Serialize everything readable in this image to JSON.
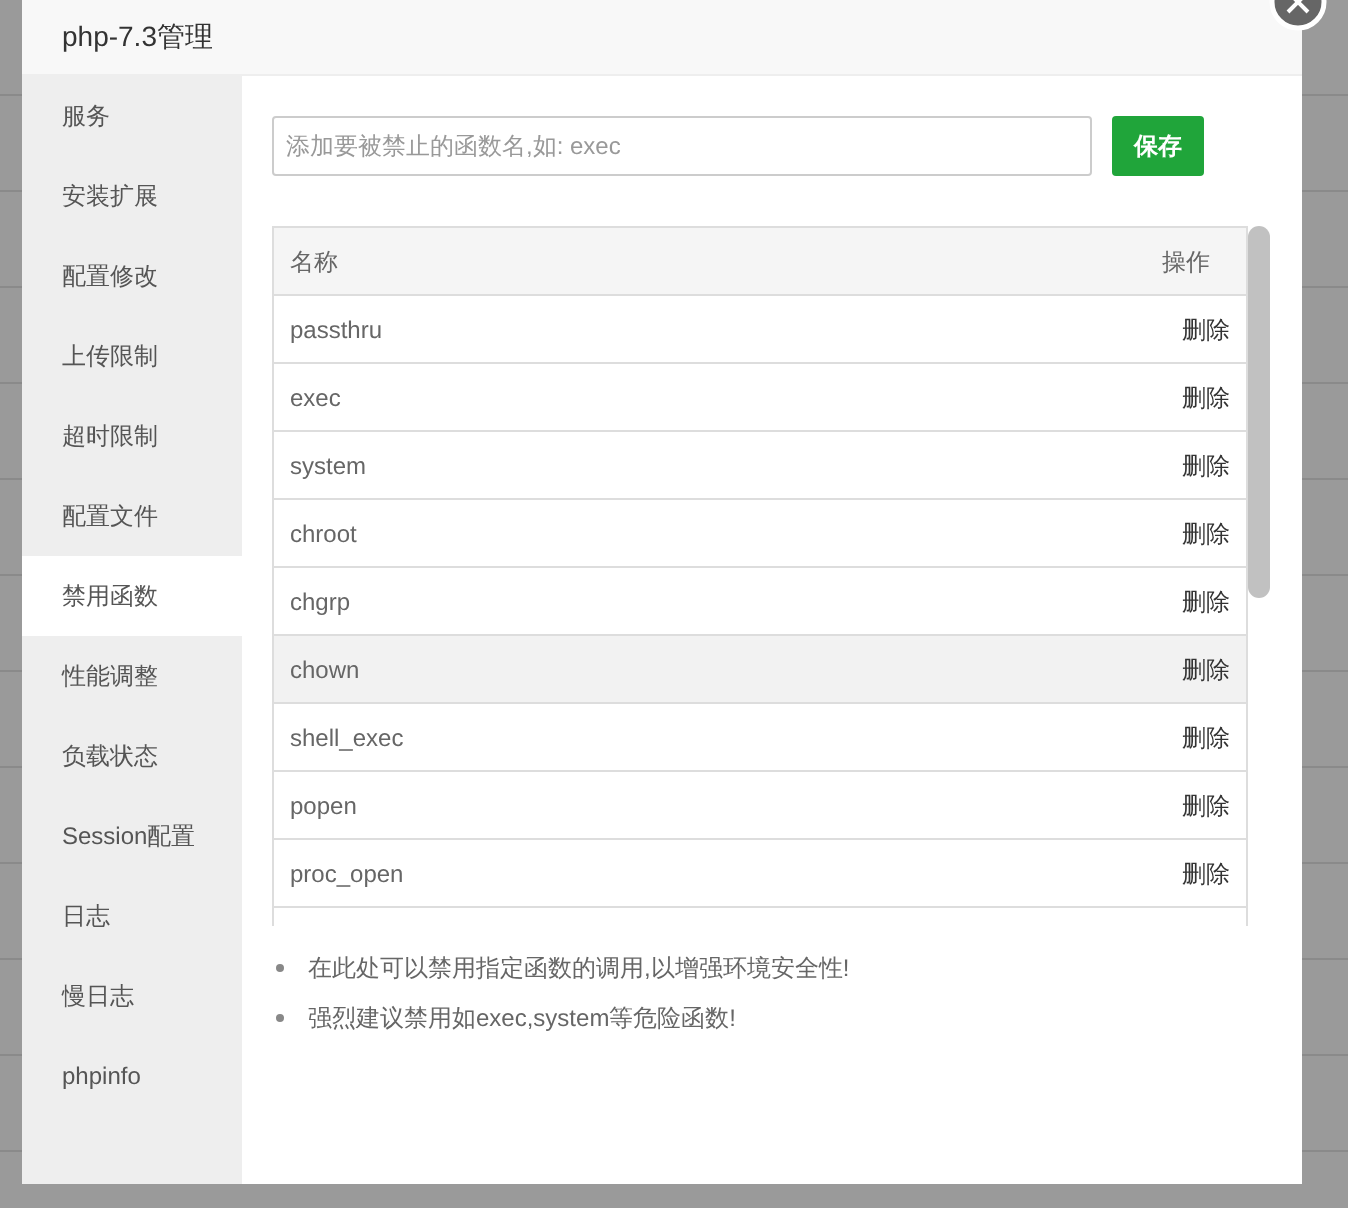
{
  "dialog": {
    "title": "php-7.3管理"
  },
  "sidebar": {
    "items": [
      {
        "label": "服务",
        "selected": false
      },
      {
        "label": "安装扩展",
        "selected": false
      },
      {
        "label": "配置修改",
        "selected": false
      },
      {
        "label": "上传限制",
        "selected": false
      },
      {
        "label": "超时限制",
        "selected": false
      },
      {
        "label": "配置文件",
        "selected": false
      },
      {
        "label": "禁用函数",
        "selected": true
      },
      {
        "label": "性能调整",
        "selected": false
      },
      {
        "label": "负载状态",
        "selected": false
      },
      {
        "label": "Session配置",
        "selected": false
      },
      {
        "label": "日志",
        "selected": false
      },
      {
        "label": "慢日志",
        "selected": false
      },
      {
        "label": "phpinfo",
        "selected": false
      }
    ]
  },
  "function_input": {
    "placeholder": "添加要被禁止的函数名,如: exec"
  },
  "save_button": "保存",
  "table": {
    "columns": [
      "名称",
      "操作"
    ],
    "rows": [
      {
        "name": "passthru",
        "action": "删除",
        "highlighted": false
      },
      {
        "name": "exec",
        "action": "删除",
        "highlighted": false
      },
      {
        "name": "system",
        "action": "删除",
        "highlighted": false
      },
      {
        "name": "chroot",
        "action": "删除",
        "highlighted": false
      },
      {
        "name": "chgrp",
        "action": "删除",
        "highlighted": false
      },
      {
        "name": "chown",
        "action": "删除",
        "highlighted": true
      },
      {
        "name": "shell_exec",
        "action": "删除",
        "highlighted": false
      },
      {
        "name": "popen",
        "action": "删除",
        "highlighted": false
      },
      {
        "name": "proc_open",
        "action": "删除",
        "highlighted": false
      }
    ]
  },
  "notes": [
    "在此处可以禁用指定函数的调用,以增强环境安全性!",
    "强烈建议禁用如exec,system等危险函数!"
  ]
}
